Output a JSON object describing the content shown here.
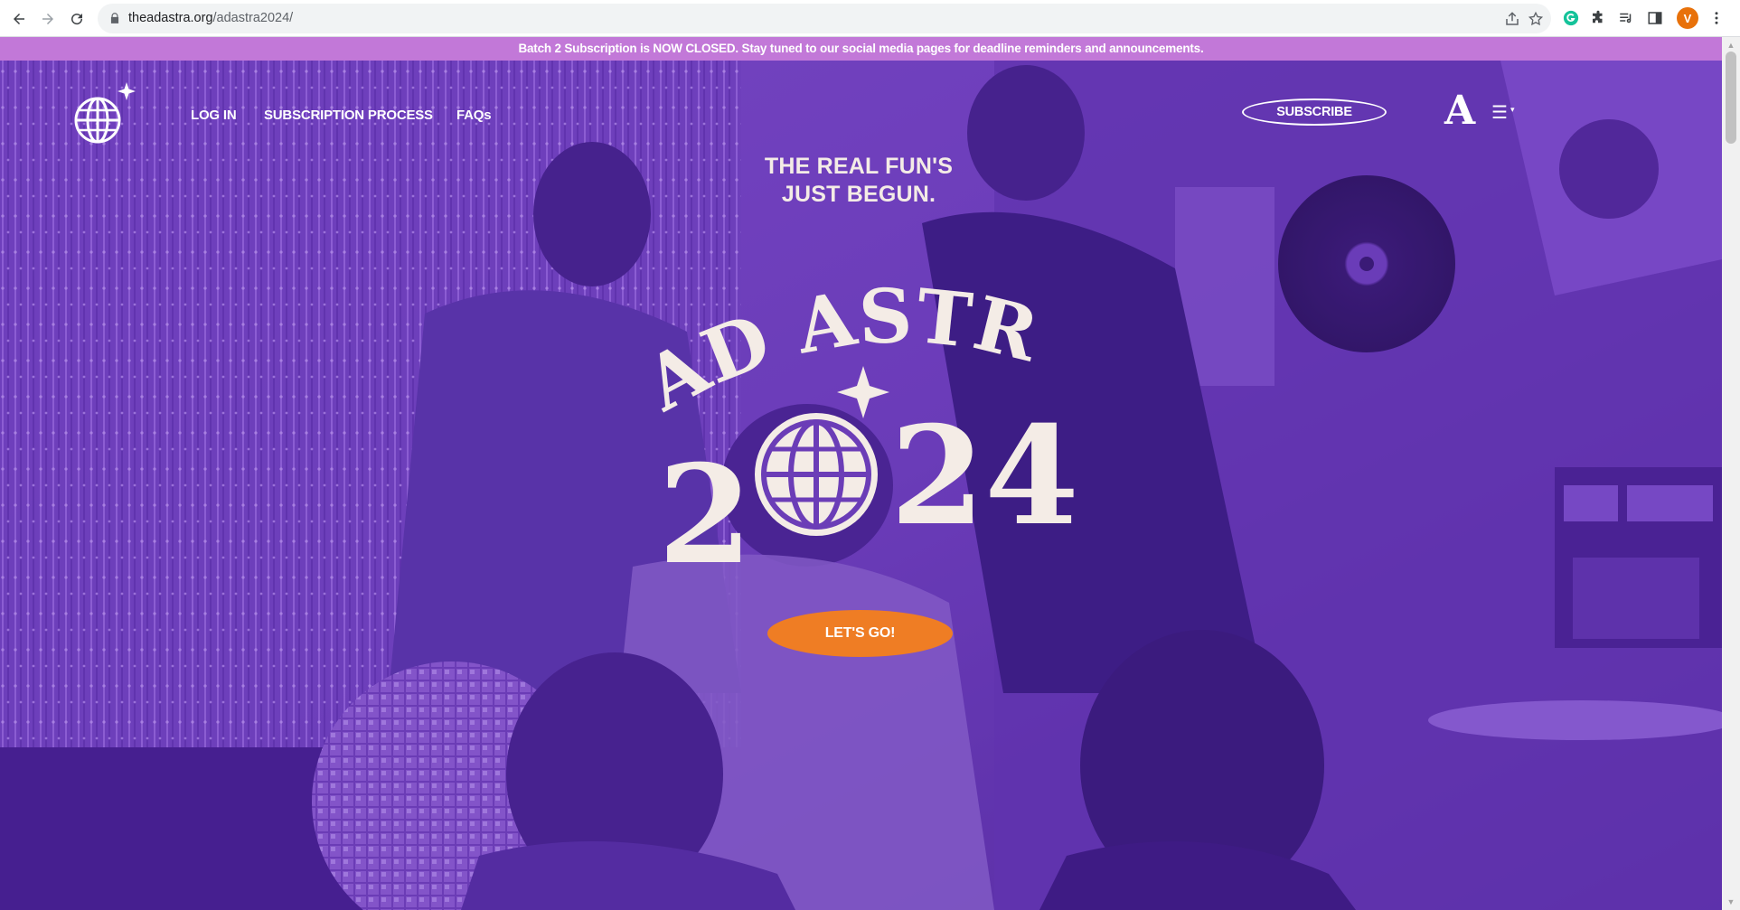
{
  "browser": {
    "url_host": "theadastra.org",
    "url_path": "/adastra2024/",
    "profile_initial": "V",
    "icons": [
      "back-arrow-icon",
      "forward-arrow-icon",
      "reload-icon",
      "lock-icon",
      "share-icon",
      "bookmark-star-icon",
      "grammarly-icon",
      "extensions-puzzle-icon",
      "media-queue-icon",
      "side-panel-icon",
      "kebab-menu-icon"
    ]
  },
  "banner": {
    "text": "Batch 2 Subscription is NOW CLOSED. Stay tuned to our social media pages for deadline reminders and announcements."
  },
  "nav": {
    "login": "LOG IN",
    "subscription_process": "SUBSCRIPTION PROCESS",
    "faqs": "FAQs",
    "subscribe": "SUBSCRIBE",
    "brand_mark": "A",
    "menu_icon": "☰",
    "menu_caret": "▾"
  },
  "hero": {
    "tagline_line1": "THE REAL FUN'S",
    "tagline_line2": "JUST BEGUN.",
    "title_line1": "AD ASTRA",
    "title_year_left": "2",
    "title_year_right": "24",
    "cta": "LET'S GO!"
  },
  "colors": {
    "banner": "#c278d8",
    "hero_purple": "#6b3db7",
    "cta_orange": "#ef7d24",
    "title_cream": "#f4ece6",
    "profile_orange": "#e8710a"
  }
}
